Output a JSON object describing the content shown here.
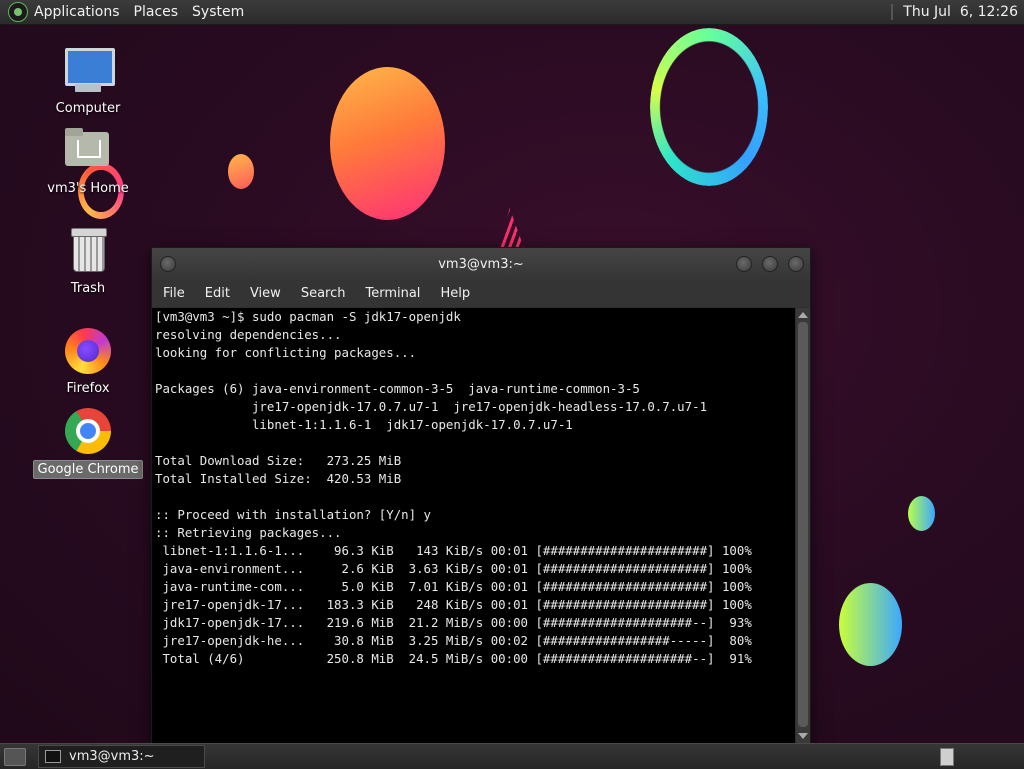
{
  "top_panel": {
    "menus": [
      "Applications",
      "Places",
      "System"
    ],
    "clock": "Thu Jul  6, 12:26"
  },
  "desktop_icons": [
    {
      "label": "Computer",
      "icon": "computer-icon"
    },
    {
      "label": "vm3's Home",
      "icon": "home-folder-icon"
    },
    {
      "label": "Trash",
      "icon": "trash-icon"
    },
    {
      "label": "Firefox",
      "icon": "firefox-icon"
    },
    {
      "label": "Google Chrome",
      "icon": "chrome-icon",
      "selected": true
    }
  ],
  "terminal": {
    "title": "vm3@vm3:~",
    "menu": [
      "File",
      "Edit",
      "View",
      "Search",
      "Terminal",
      "Help"
    ],
    "lines": [
      "[vm3@vm3 ~]$ sudo pacman -S jdk17-openjdk",
      "resolving dependencies...",
      "looking for conflicting packages...",
      "",
      "Packages (6) java-environment-common-3-5  java-runtime-common-3-5",
      "             jre17-openjdk-17.0.7.u7-1  jre17-openjdk-headless-17.0.7.u7-1",
      "             libnet-1:1.1.6-1  jdk17-openjdk-17.0.7.u7-1",
      "",
      "Total Download Size:   273.25 MiB",
      "Total Installed Size:  420.53 MiB",
      "",
      ":: Proceed with installation? [Y/n] y",
      ":: Retrieving packages...",
      " libnet-1:1.1.6-1...    96.3 KiB   143 KiB/s 00:01 [######################] 100%",
      " java-environment...     2.6 KiB  3.63 KiB/s 00:01 [######################] 100%",
      " java-runtime-com...     5.0 KiB  7.01 KiB/s 00:01 [######################] 100%",
      " jre17-openjdk-17...   183.3 KiB   248 KiB/s 00:01 [######################] 100%",
      " jdk17-openjdk-17...   219.6 MiB  21.2 MiB/s 00:00 [####################--]  93%",
      " jre17-openjdk-he...    30.8 MiB  3.25 MiB/s 00:02 [#################-----]  80%",
      " Total (4/6)           250.8 MiB  24.5 MiB/s 00:00 [####################--]  91%"
    ]
  },
  "taskbar": {
    "window_button": "vm3@vm3:~"
  }
}
